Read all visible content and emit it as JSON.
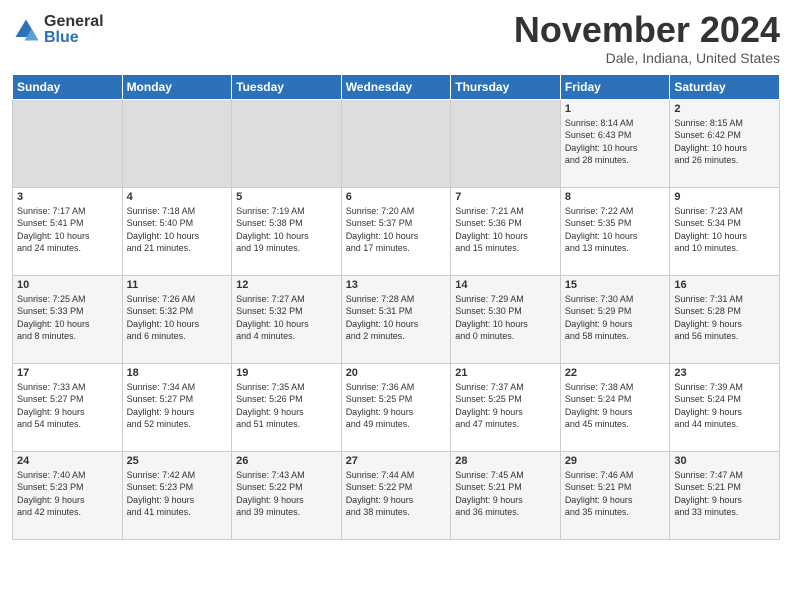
{
  "header": {
    "title": "November 2024",
    "location": "Dale, Indiana, United States",
    "logo_general": "General",
    "logo_blue": "Blue"
  },
  "days_of_week": [
    "Sunday",
    "Monday",
    "Tuesday",
    "Wednesday",
    "Thursday",
    "Friday",
    "Saturday"
  ],
  "weeks": [
    [
      {
        "day": "",
        "info": ""
      },
      {
        "day": "",
        "info": ""
      },
      {
        "day": "",
        "info": ""
      },
      {
        "day": "",
        "info": ""
      },
      {
        "day": "",
        "info": ""
      },
      {
        "day": "1",
        "info": "Sunrise: 8:14 AM\nSunset: 6:43 PM\nDaylight: 10 hours\nand 28 minutes."
      },
      {
        "day": "2",
        "info": "Sunrise: 8:15 AM\nSunset: 6:42 PM\nDaylight: 10 hours\nand 26 minutes."
      }
    ],
    [
      {
        "day": "3",
        "info": "Sunrise: 7:17 AM\nSunset: 5:41 PM\nDaylight: 10 hours\nand 24 minutes."
      },
      {
        "day": "4",
        "info": "Sunrise: 7:18 AM\nSunset: 5:40 PM\nDaylight: 10 hours\nand 21 minutes."
      },
      {
        "day": "5",
        "info": "Sunrise: 7:19 AM\nSunset: 5:38 PM\nDaylight: 10 hours\nand 19 minutes."
      },
      {
        "day": "6",
        "info": "Sunrise: 7:20 AM\nSunset: 5:37 PM\nDaylight: 10 hours\nand 17 minutes."
      },
      {
        "day": "7",
        "info": "Sunrise: 7:21 AM\nSunset: 5:36 PM\nDaylight: 10 hours\nand 15 minutes."
      },
      {
        "day": "8",
        "info": "Sunrise: 7:22 AM\nSunset: 5:35 PM\nDaylight: 10 hours\nand 13 minutes."
      },
      {
        "day": "9",
        "info": "Sunrise: 7:23 AM\nSunset: 5:34 PM\nDaylight: 10 hours\nand 10 minutes."
      }
    ],
    [
      {
        "day": "10",
        "info": "Sunrise: 7:25 AM\nSunset: 5:33 PM\nDaylight: 10 hours\nand 8 minutes."
      },
      {
        "day": "11",
        "info": "Sunrise: 7:26 AM\nSunset: 5:32 PM\nDaylight: 10 hours\nand 6 minutes."
      },
      {
        "day": "12",
        "info": "Sunrise: 7:27 AM\nSunset: 5:32 PM\nDaylight: 10 hours\nand 4 minutes."
      },
      {
        "day": "13",
        "info": "Sunrise: 7:28 AM\nSunset: 5:31 PM\nDaylight: 10 hours\nand 2 minutes."
      },
      {
        "day": "14",
        "info": "Sunrise: 7:29 AM\nSunset: 5:30 PM\nDaylight: 10 hours\nand 0 minutes."
      },
      {
        "day": "15",
        "info": "Sunrise: 7:30 AM\nSunset: 5:29 PM\nDaylight: 9 hours\nand 58 minutes."
      },
      {
        "day": "16",
        "info": "Sunrise: 7:31 AM\nSunset: 5:28 PM\nDaylight: 9 hours\nand 56 minutes."
      }
    ],
    [
      {
        "day": "17",
        "info": "Sunrise: 7:33 AM\nSunset: 5:27 PM\nDaylight: 9 hours\nand 54 minutes."
      },
      {
        "day": "18",
        "info": "Sunrise: 7:34 AM\nSunset: 5:27 PM\nDaylight: 9 hours\nand 52 minutes."
      },
      {
        "day": "19",
        "info": "Sunrise: 7:35 AM\nSunset: 5:26 PM\nDaylight: 9 hours\nand 51 minutes."
      },
      {
        "day": "20",
        "info": "Sunrise: 7:36 AM\nSunset: 5:25 PM\nDaylight: 9 hours\nand 49 minutes."
      },
      {
        "day": "21",
        "info": "Sunrise: 7:37 AM\nSunset: 5:25 PM\nDaylight: 9 hours\nand 47 minutes."
      },
      {
        "day": "22",
        "info": "Sunrise: 7:38 AM\nSunset: 5:24 PM\nDaylight: 9 hours\nand 45 minutes."
      },
      {
        "day": "23",
        "info": "Sunrise: 7:39 AM\nSunset: 5:24 PM\nDaylight: 9 hours\nand 44 minutes."
      }
    ],
    [
      {
        "day": "24",
        "info": "Sunrise: 7:40 AM\nSunset: 5:23 PM\nDaylight: 9 hours\nand 42 minutes."
      },
      {
        "day": "25",
        "info": "Sunrise: 7:42 AM\nSunset: 5:23 PM\nDaylight: 9 hours\nand 41 minutes."
      },
      {
        "day": "26",
        "info": "Sunrise: 7:43 AM\nSunset: 5:22 PM\nDaylight: 9 hours\nand 39 minutes."
      },
      {
        "day": "27",
        "info": "Sunrise: 7:44 AM\nSunset: 5:22 PM\nDaylight: 9 hours\nand 38 minutes."
      },
      {
        "day": "28",
        "info": "Sunrise: 7:45 AM\nSunset: 5:21 PM\nDaylight: 9 hours\nand 36 minutes."
      },
      {
        "day": "29",
        "info": "Sunrise: 7:46 AM\nSunset: 5:21 PM\nDaylight: 9 hours\nand 35 minutes."
      },
      {
        "day": "30",
        "info": "Sunrise: 7:47 AM\nSunset: 5:21 PM\nDaylight: 9 hours\nand 33 minutes."
      }
    ]
  ]
}
